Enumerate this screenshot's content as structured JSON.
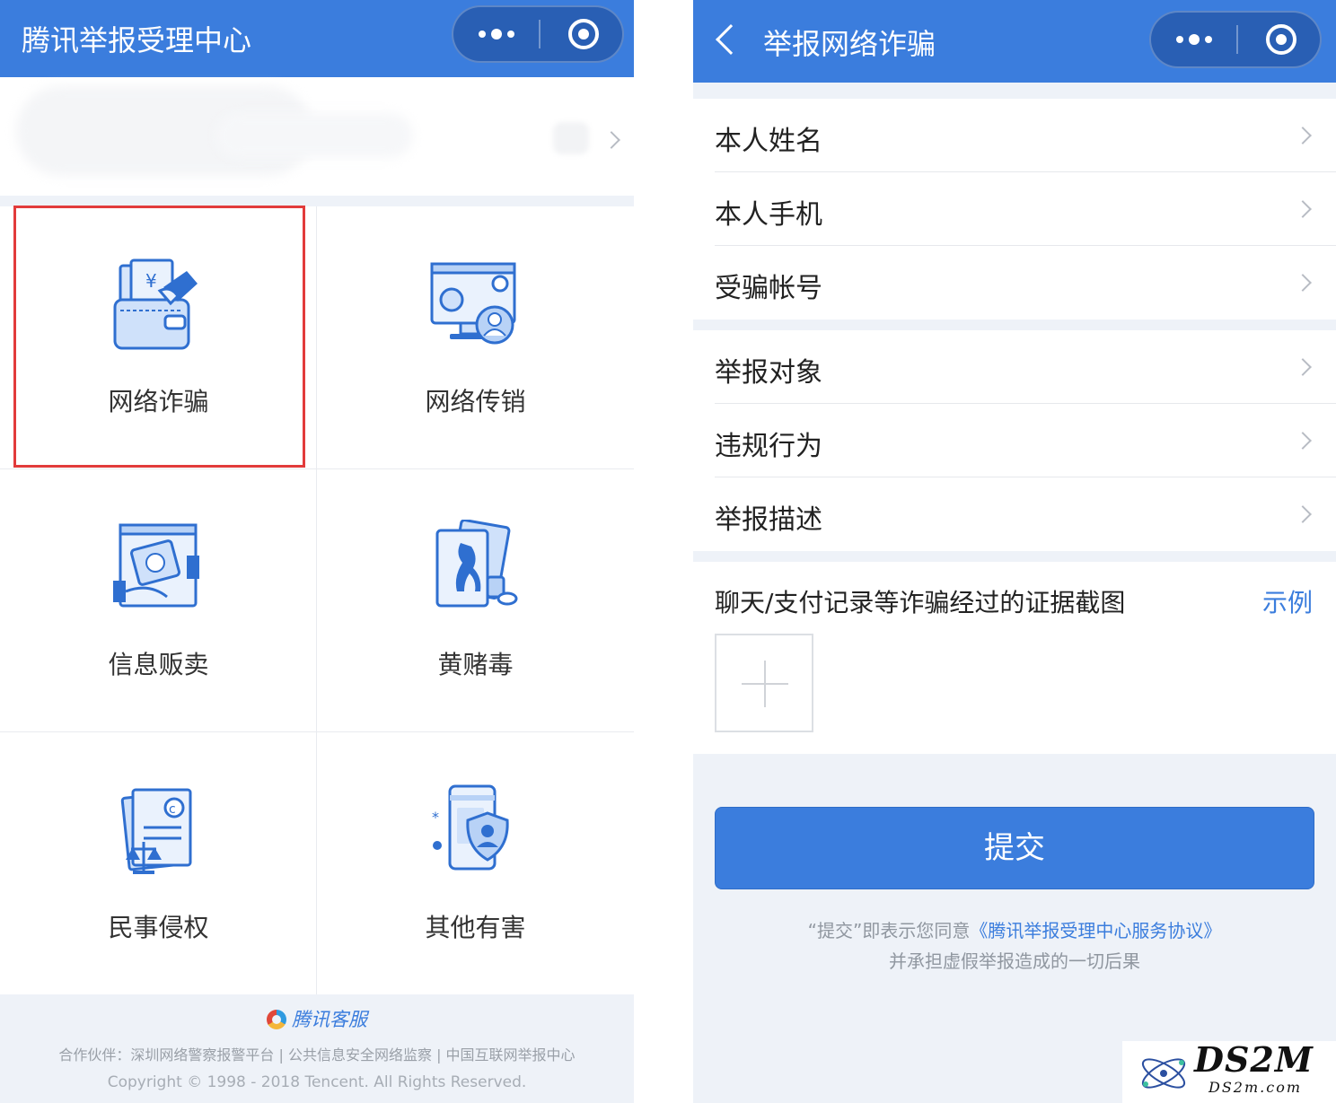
{
  "left": {
    "title": "腾讯举报受理中心",
    "categories": [
      {
        "label": "网络诈骗",
        "icon": "wallet-money-icon"
      },
      {
        "label": "网络传销",
        "icon": "monitor-network-icon"
      },
      {
        "label": "信息贩卖",
        "icon": "money-exchange-icon"
      },
      {
        "label": "黄赌毒",
        "icon": "cards-pills-icon"
      },
      {
        "label": "民事侵权",
        "icon": "copyright-scales-icon"
      },
      {
        "label": "其他有害",
        "icon": "phone-shield-icon"
      }
    ],
    "footer": {
      "brand": "腾讯客服",
      "partners": "合作伙伴：深圳网络警察报警平台 | 公共信息安全网络监察 | 中国互联网举报中心",
      "copyright": "Copyright © 1998 - 2018 Tencent. All Rights Reserved."
    }
  },
  "right": {
    "title": "举报网络诈骗",
    "group1": [
      "本人姓名",
      "本人手机",
      "受骗帐号"
    ],
    "group2": [
      "举报对象",
      "违规行为",
      "举报描述"
    ],
    "evidence_label": "聊天/支付记录等诈骗经过的证据截图",
    "example_link": "示例",
    "submit_label": "提交",
    "agree_prefix": "“提交”即表示您同意",
    "agree_link": "《腾讯举报受理中心服务协议》",
    "agree_line2": "并承担虚假举报造成的一切后果"
  },
  "watermark": {
    "brand": "DS2M",
    "domain": "DS2m.com"
  },
  "colors": {
    "accent": "#3b7ddd",
    "selection": "#e23b3b",
    "background": "#eef2f8"
  }
}
